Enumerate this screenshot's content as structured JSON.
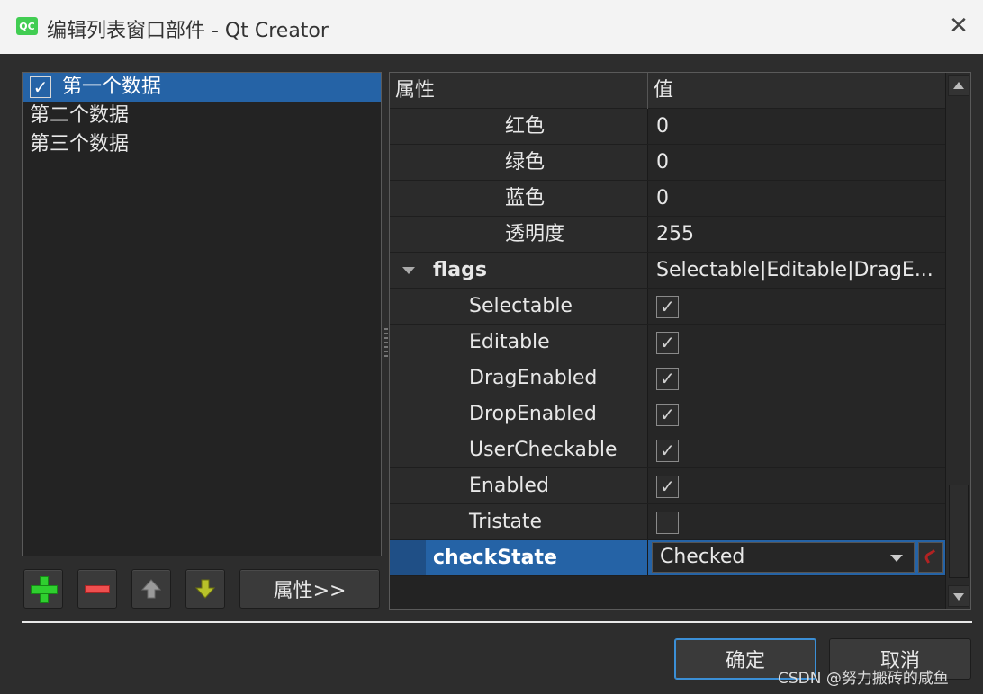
{
  "window": {
    "app_icon_text": "QC",
    "title": "编辑列表窗口部件 - Qt Creator",
    "close_symbol": "✕"
  },
  "list": {
    "items": [
      {
        "label": "第一个数据",
        "checked": true,
        "selected": true
      },
      {
        "label": "第二个数据",
        "checked": false,
        "selected": false
      },
      {
        "label": "第三个数据",
        "checked": false,
        "selected": false
      }
    ],
    "check_mark": "✓"
  },
  "toolbar": {
    "add_icon": "plus-icon",
    "remove_icon": "minus-icon",
    "up_icon": "arrow-up-icon",
    "down_icon": "arrow-down-icon",
    "properties_label": "属性>>"
  },
  "properties": {
    "header": {
      "name": "属性",
      "value": "值"
    },
    "rows": [
      {
        "name": "红色",
        "value": "0"
      },
      {
        "name": "绿色",
        "value": "0"
      },
      {
        "name": "蓝色",
        "value": "0"
      },
      {
        "name": "透明度",
        "value": "255"
      },
      {
        "name": "flags",
        "value": "Selectable|Editable|DragE..."
      },
      {
        "name": "Selectable",
        "checked": true
      },
      {
        "name": "Editable",
        "checked": true
      },
      {
        "name": "DragEnabled",
        "checked": true
      },
      {
        "name": "DropEnabled",
        "checked": true
      },
      {
        "name": "UserCheckable",
        "checked": true
      },
      {
        "name": "Enabled",
        "checked": true
      },
      {
        "name": "Tristate",
        "checked": false
      },
      {
        "name": "checkState",
        "value": "Checked"
      }
    ]
  },
  "dialog": {
    "ok_label": "确定",
    "cancel_label": "取消"
  },
  "watermark": "CSDN @努力搬砖的咸鱼",
  "colors": {
    "selection": "#2563a6",
    "background": "#2d2d2d",
    "add_green": "#2fcf2f",
    "remove_red": "#ef4f4f"
  }
}
